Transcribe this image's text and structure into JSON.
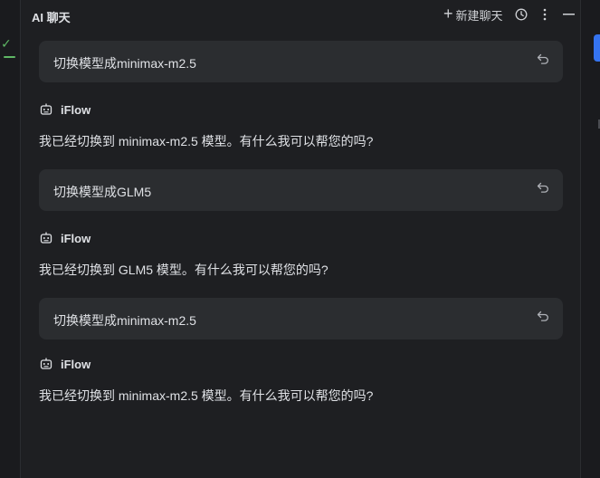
{
  "header": {
    "title": "AI 聊天",
    "new_chat_label": "新建聊天"
  },
  "messages": [
    {
      "user_text": "切换模型成minimax-m2.5",
      "bot_name": "iFlow",
      "bot_text": "我已经切换到 minimax-m2.5 模型。有什么我可以帮您的吗?"
    },
    {
      "user_text": "切换模型成GLM5",
      "bot_name": "iFlow",
      "bot_text": "我已经切换到 GLM5 模型。有什么我可以帮您的吗?"
    },
    {
      "user_text": "切换模型成minimax-m2.5",
      "bot_name": "iFlow",
      "bot_text": "我已经切换到 minimax-m2.5 模型。有什么我可以帮您的吗?"
    }
  ],
  "icons": {
    "new_chat": "plus-icon",
    "history": "clock-icon",
    "more": "more-vertical-icon",
    "minimize": "minimize-icon",
    "undo": "undo-icon",
    "bot": "robot-icon",
    "status": "check-icon"
  },
  "colors": {
    "background": "#1e1f22",
    "bubble": "#2b2d30",
    "text": "#dfe1e5",
    "accent": "#3574f0",
    "success": "#5fb865"
  }
}
